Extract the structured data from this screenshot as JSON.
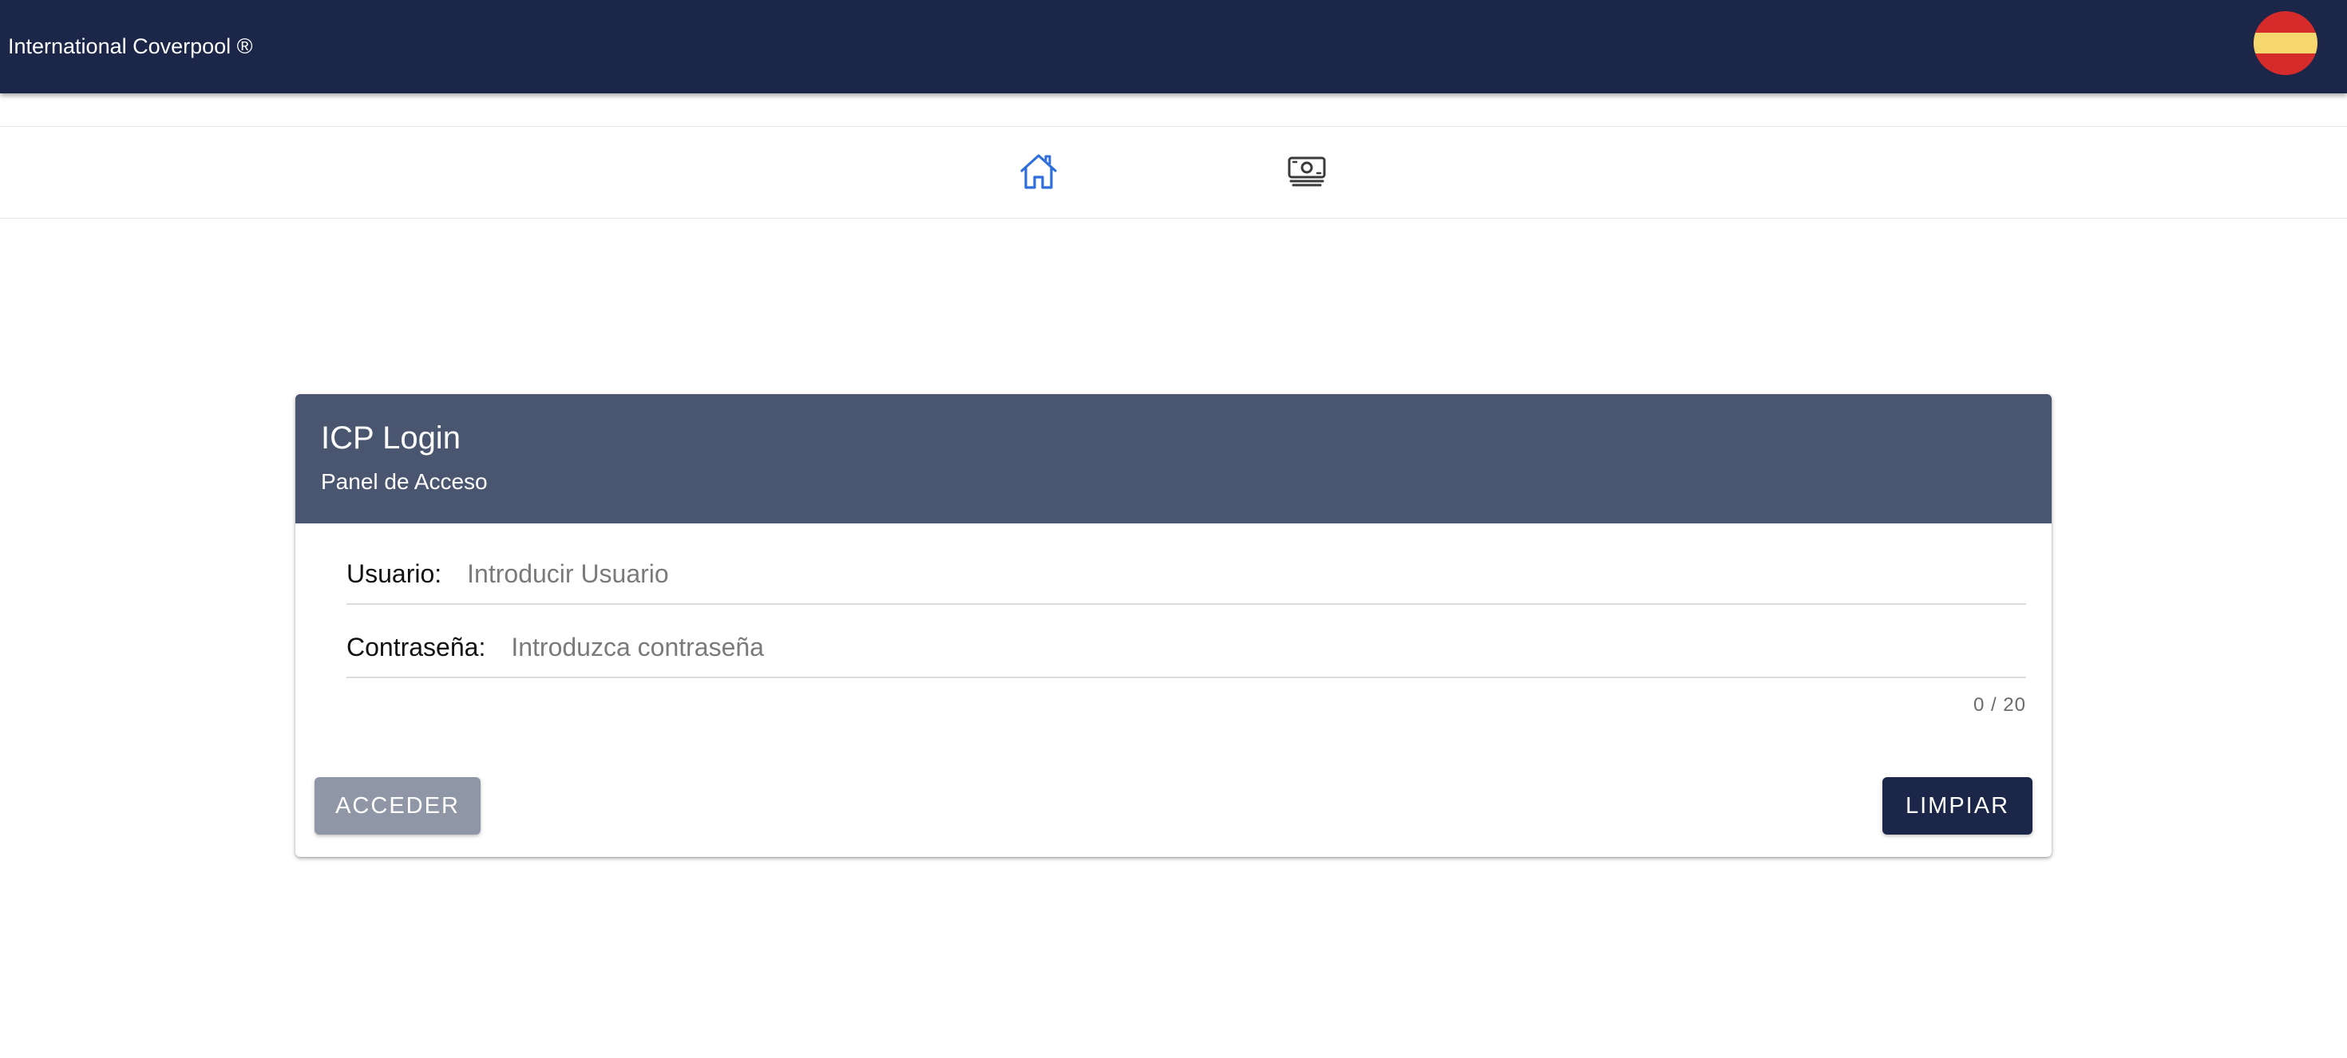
{
  "appbar": {
    "title": "International Coverpool ®",
    "language_flag": "spain-flag-icon"
  },
  "nav": {
    "items": [
      {
        "name": "home",
        "icon": "home-icon",
        "active": true
      },
      {
        "name": "payments",
        "icon": "money-icon",
        "active": false
      }
    ]
  },
  "login": {
    "title": "ICP Login",
    "subtitle": "Panel de Acceso",
    "username": {
      "label": "Usuario:",
      "placeholder": "Introducir Usuario",
      "value": ""
    },
    "password": {
      "label": "Contraseña:",
      "placeholder": "Introduzca contraseña",
      "value": "",
      "counter": "0 / 20"
    },
    "submit_label": "ACCEDER",
    "clear_label": "LIMPIAR"
  },
  "colors": {
    "appbar": "#1b2649",
    "card_header": "#4a556f",
    "active_icon": "#2f6fdc",
    "inactive_icon": "#3a3a3a",
    "button_disabled": "#8f96a6",
    "button_primary": "#1b2649"
  }
}
